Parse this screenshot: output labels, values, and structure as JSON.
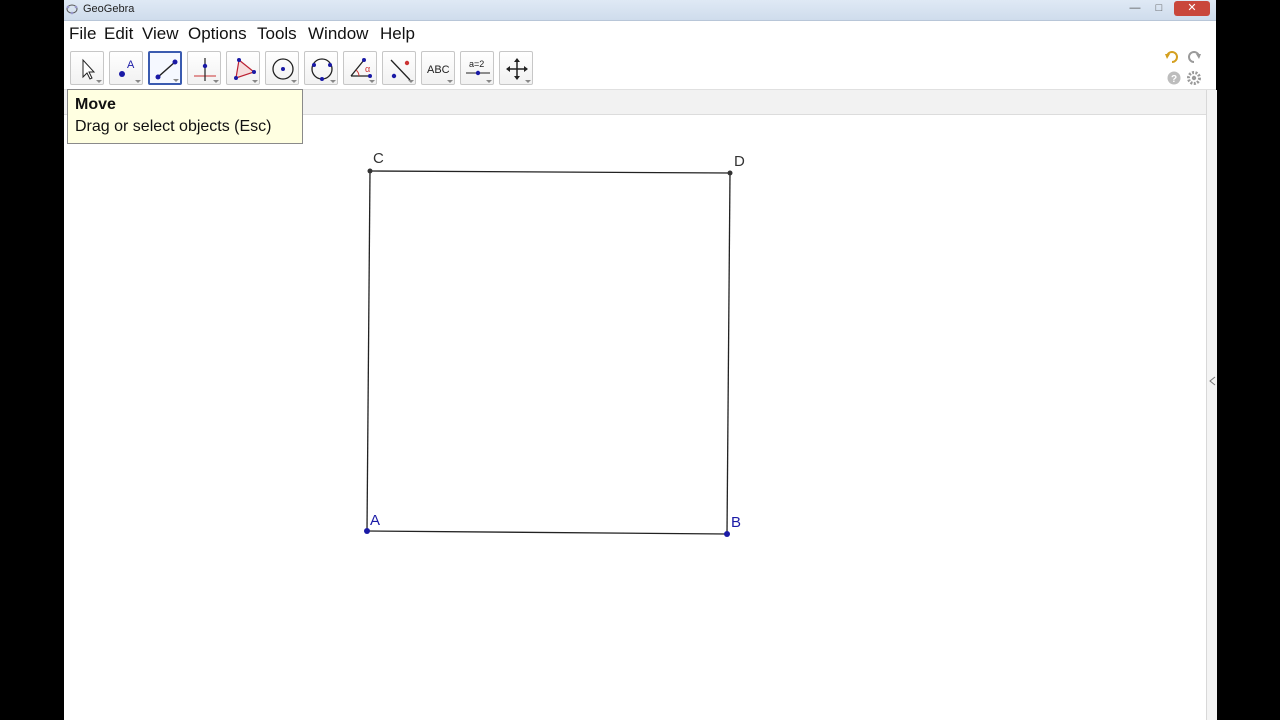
{
  "window": {
    "title": "GeoGebra",
    "minimize": "—",
    "restore": "□",
    "close": "✕"
  },
  "menu": [
    "File",
    "Edit",
    "View",
    "Options",
    "Tools",
    "Window",
    "Help"
  ],
  "toolbar": {
    "tools": [
      {
        "name": "move-tool-icon"
      },
      {
        "name": "point-tool-icon"
      },
      {
        "name": "line-tool-icon"
      },
      {
        "name": "perpendicular-tool-icon"
      },
      {
        "name": "polygon-tool-icon"
      },
      {
        "name": "circle-tool-icon"
      },
      {
        "name": "conic-tool-icon"
      },
      {
        "name": "angle-tool-icon"
      },
      {
        "name": "reflect-tool-icon"
      },
      {
        "name": "text-tool-icon",
        "label": "ABC"
      },
      {
        "name": "slider-tool-icon",
        "label": "a=2"
      },
      {
        "name": "move-graphics-tool-icon"
      }
    ],
    "selected_index": 2
  },
  "tooltip": {
    "title": "Move",
    "description": "Drag or select objects (Esc)"
  },
  "points": {
    "A": {
      "label": "A",
      "color": "#1a1aa6"
    },
    "B": {
      "label": "B",
      "color": "#1a1aa6"
    },
    "C": {
      "label": "C",
      "color": "#333333"
    },
    "D": {
      "label": "D",
      "color": "#333333"
    }
  },
  "colors": {
    "selected_tool_border": "#3a5bb0",
    "tooltip_bg": "#ffffe1",
    "free_point": "#1a1aa6"
  }
}
